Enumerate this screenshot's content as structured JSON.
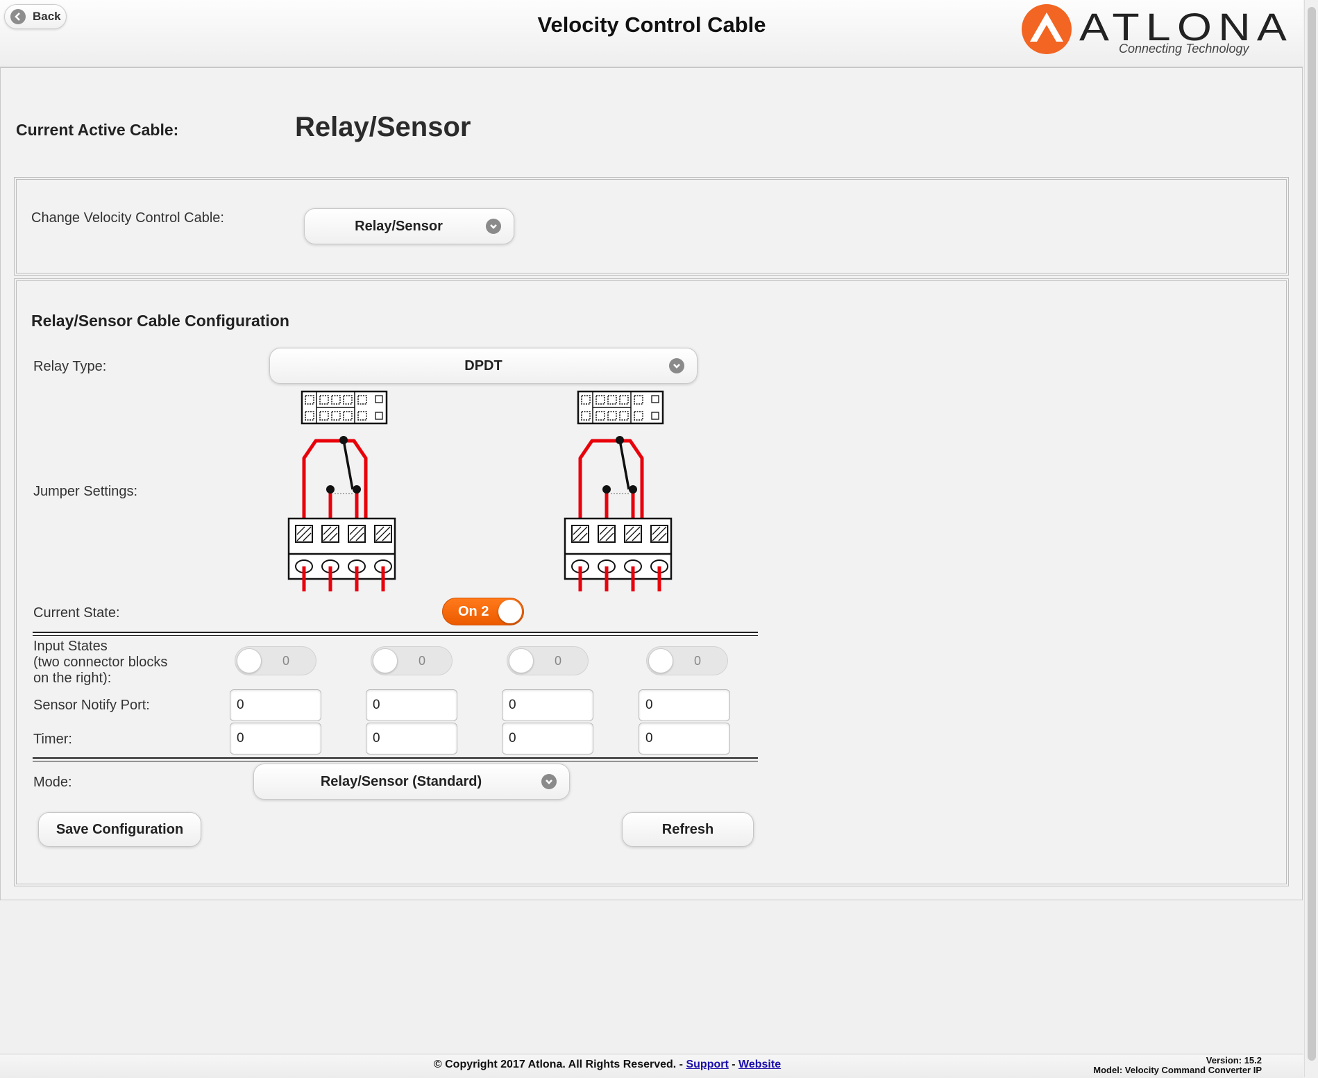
{
  "header": {
    "back_label": "Back",
    "title": "Velocity Control Cable",
    "logo_text": "ATLONA",
    "logo_tagline": "Connecting Technology",
    "brand_color": "#f26522"
  },
  "active_cable": {
    "label": "Current Active Cable:",
    "value": "Relay/Sensor"
  },
  "change_cable": {
    "label": "Change Velocity Control Cable:",
    "selected": "Relay/Sensor"
  },
  "config": {
    "title": "Relay/Sensor Cable Configuration",
    "relay_type_label": "Relay Type:",
    "relay_type_selected": "DPDT",
    "jumper_label": "Jumper Settings:",
    "current_state_label": "Current State:",
    "current_state_value": "On 2",
    "input_states_label_1": "Input States",
    "input_states_label_2": "(two connector blocks",
    "input_states_label_3": "on the right):",
    "input_states": [
      "0",
      "0",
      "0",
      "0"
    ],
    "sensor_notify_label": "Sensor Notify Port:",
    "sensor_notify_ports": [
      "0",
      "0",
      "0",
      "0"
    ],
    "timer_label": "Timer:",
    "timers": [
      "0",
      "0",
      "0",
      "0"
    ],
    "mode_label": "Mode:",
    "mode_selected": "Relay/Sensor (Standard)",
    "save_label": "Save Configuration",
    "refresh_label": "Refresh"
  },
  "footer": {
    "copyright": "© Copyright 2017 Atlona. All Rights Reserved. -",
    "sep": "-",
    "support_link": "Support",
    "website_link": "Website",
    "version": "Version: 15.2",
    "model": "Model: Velocity Command Converter IP"
  }
}
